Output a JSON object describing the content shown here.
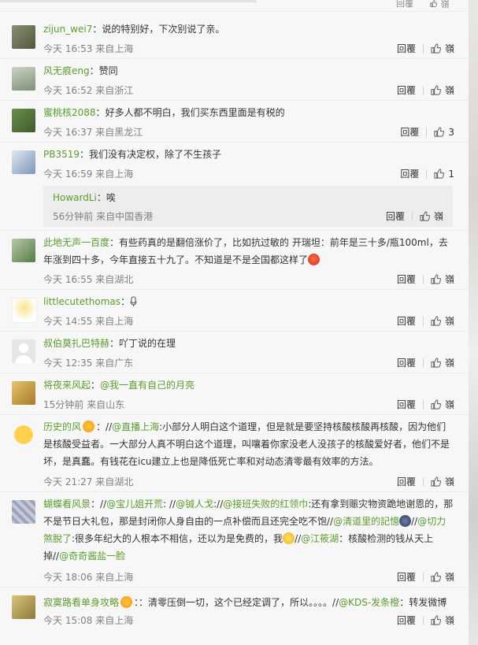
{
  "top": {
    "reply_label": "回覆",
    "like_label": "嶺"
  },
  "labels": {
    "reply": "回覆",
    "like_zero": "嶺"
  },
  "comments": [
    {
      "user": "zijun_wei7",
      "text": "说的特别好，下次别说了亲。",
      "time": "今天 16:53 来自上海",
      "likes": "嶺"
    },
    {
      "user": "风无痕eng",
      "text": "赞同",
      "time": "今天 16:52 来自浙江",
      "likes": "嶺"
    },
    {
      "user": "蜜桃核2088",
      "text": "好多人都不明白，我们买东西里面是有税的",
      "time": "今天 16:37 来自黑龙江",
      "likes": "3"
    },
    {
      "user": "PB3519",
      "text": "我们没有决定权，除了不生孩子",
      "time": "今天 16:59 来自上海",
      "likes": "1"
    },
    {
      "user": "此地无声一百度",
      "text": "有些药真的是翻倍涨价了，比如抗过敏的 开瑞坦：前年是三十多/瓶100ml，去年涨到四十多，今年直接五十九了。不知道是不是全国都这样了",
      "time": "今天 16:55 来自湖北",
      "likes": "嶺"
    },
    {
      "user": "littlecutethomas",
      "text": "",
      "time": "今天 14:55 来自上海",
      "likes": "嶺"
    },
    {
      "user": "叔伯莫扎巴特赫",
      "text": "吖丁说的在理",
      "time": "今天 12:35 来自广东",
      "likes": "嶺"
    },
    {
      "user": "将夜来风起",
      "text": "",
      "time": "15分钟前 来自山东",
      "likes": "嶺"
    },
    {
      "user": "历史的风",
      "text": "",
      "time": "今天 21:27 来自湖北",
      "likes": "嶺"
    },
    {
      "user": "蝴蝶看风景",
      "text": "",
      "time": "今天 18:06 来自上海",
      "likes": "嶺"
    },
    {
      "user": "寂寞路看单身攻略",
      "text": "",
      "time": "今天 15:08 来自上海",
      "likes": "嶺"
    }
  ],
  "subreply": {
    "user": "HowardLi",
    "text": "唉",
    "time": "56分钟前 来自中国香港",
    "likes": "嶺"
  },
  "rich": {
    "c8_at": "@我一直有自己的月亮",
    "c9_part1": "//",
    "c9_at1": "@直播上海",
    "c9_part2": ":小部分人明白这个道理，但是就是要坚持核酸核酸再核酸，因为他们是核酸受益者。一大部分人真不明白这个道理，叫嚷着你家没老人没孩子的核酸爱好者，他们不是坏，是真蠢。有钱花在icu建立上也是降低死亡率和对动态清零最有效率的方法。",
    "c10_p1": "//",
    "c10_at1": "@宝儿姐开荒",
    "c10_p2": ": //",
    "c10_at2": "@铖人戈",
    "c10_p3": "://",
    "c10_at3": "@接班失败的红领巾",
    "c10_p4": ":还有拿到赈灾物资跪地谢恩的，那不是节日大礼包，那是封闭你人身自由的一点补偿而且还完全吃不饱//",
    "c10_at4": "@清道里的記憶",
    "c10_p5": "//",
    "c10_at5": "@切力煞脫了",
    "c10_p6": ":很多年纪大的人根本不相信，还以为是免费的，我",
    "c10_p7": "//",
    "c10_at6": "@江筱湖",
    "c10_p8": "：核酸检测的钱从天上掉//",
    "c10_at7": "@奇奇酱盐一脸",
    "c11_p1": "：清零压倒一切，这个已经定调了，所以。。。。//",
    "c11_at1": "@KDS-发条橙",
    "c11_p2": "：转发微博"
  },
  "colors": {
    "accent": "#5a9e2b",
    "meta": "#808080",
    "panel": "#f7f7f7",
    "reply_bg": "#ededed"
  },
  "icons": [
    "thumb-up-icon",
    "emoji-icon",
    "microphone-icon",
    "badge-icon"
  ]
}
